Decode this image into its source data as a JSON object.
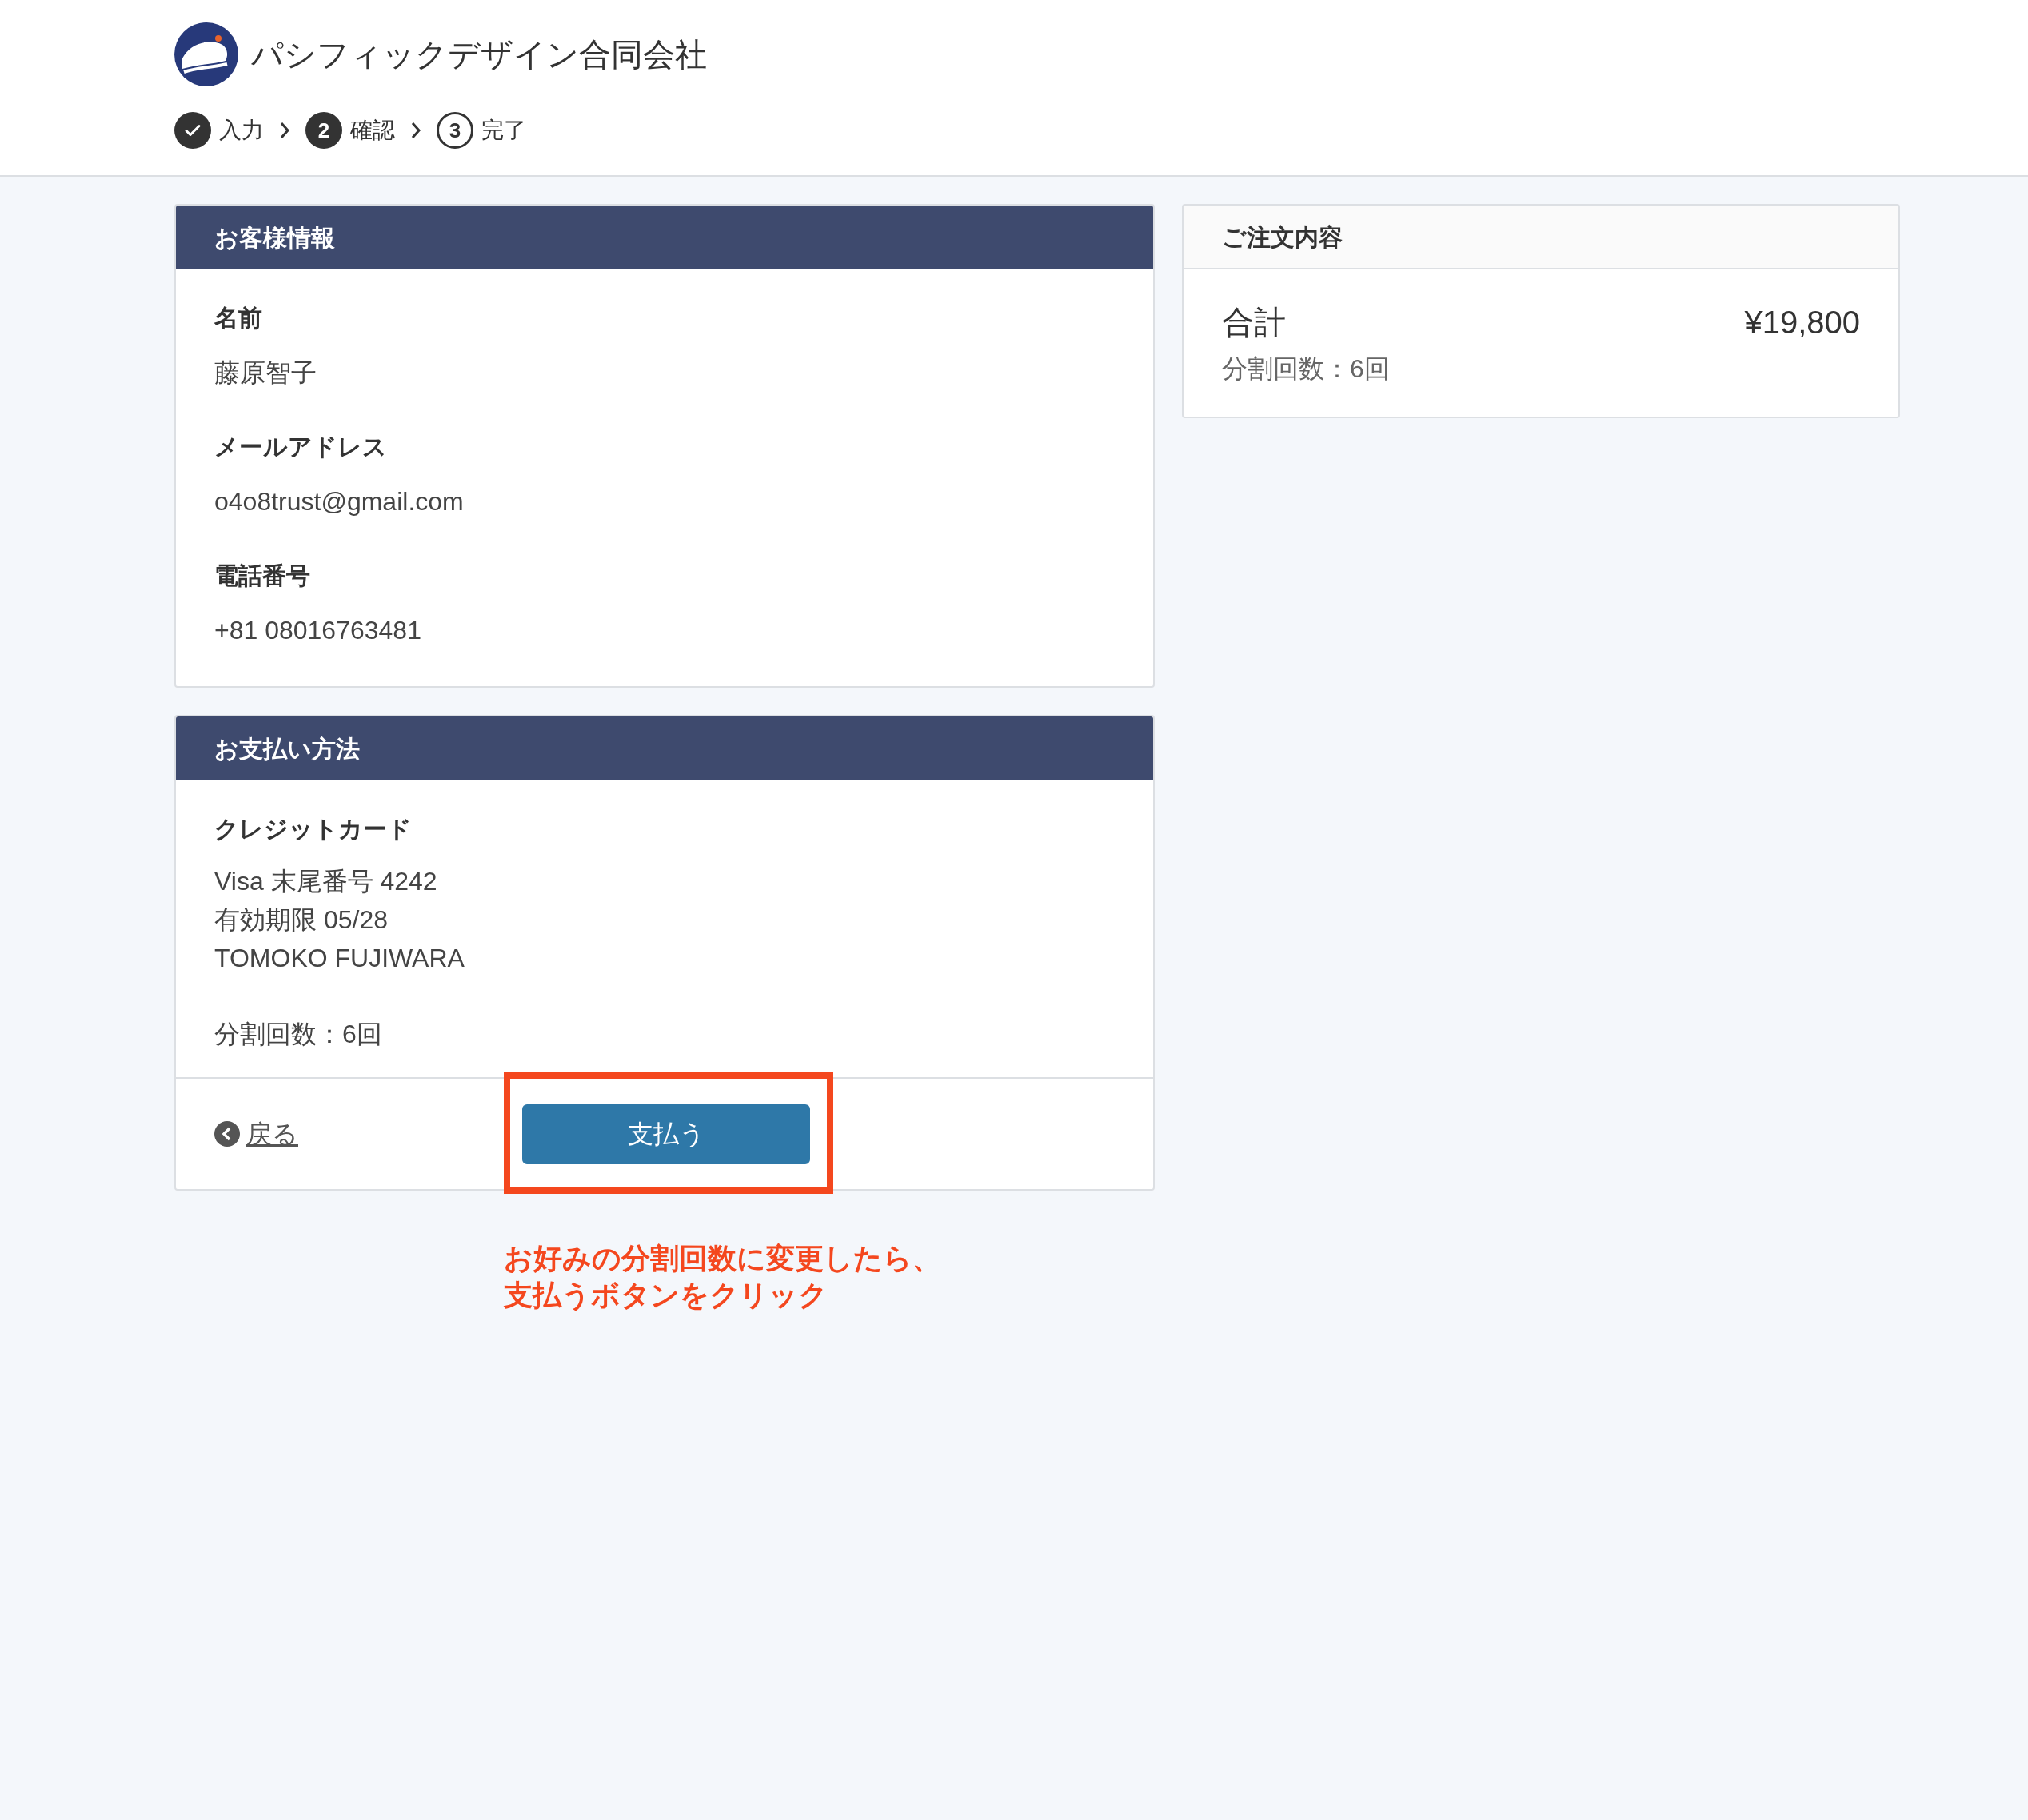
{
  "header": {
    "company": "パシフィックデザイン合同会社"
  },
  "steps": [
    {
      "label": "入力",
      "kind": "done"
    },
    {
      "number": "2",
      "label": "確認",
      "kind": "current"
    },
    {
      "number": "3",
      "label": "完了",
      "kind": "upcoming"
    }
  ],
  "customer": {
    "title": "お客様情報",
    "fields": [
      {
        "label": "名前",
        "value": "藤原智子"
      },
      {
        "label": "メールアドレス",
        "value": "o4o8trust@gmail.com"
      },
      {
        "label": "電話番号",
        "value": "+81 08016763481"
      }
    ]
  },
  "payment": {
    "title": "お支払い方法",
    "method": "クレジットカード",
    "lines": [
      "Visa 末尾番号 4242",
      "有効期限 05/28",
      "TOMOKO FUJIWARA"
    ],
    "installments": "分割回数：6回",
    "back": "戻る",
    "pay": "支払う"
  },
  "annotation": {
    "lines": [
      "お好みの分割回数に変更したら、",
      "支払うボタンをクリック"
    ]
  },
  "order": {
    "title": "ご注文内容",
    "total_label": "合計",
    "total": "¥19,800",
    "installments": "分割回数：6回"
  }
}
